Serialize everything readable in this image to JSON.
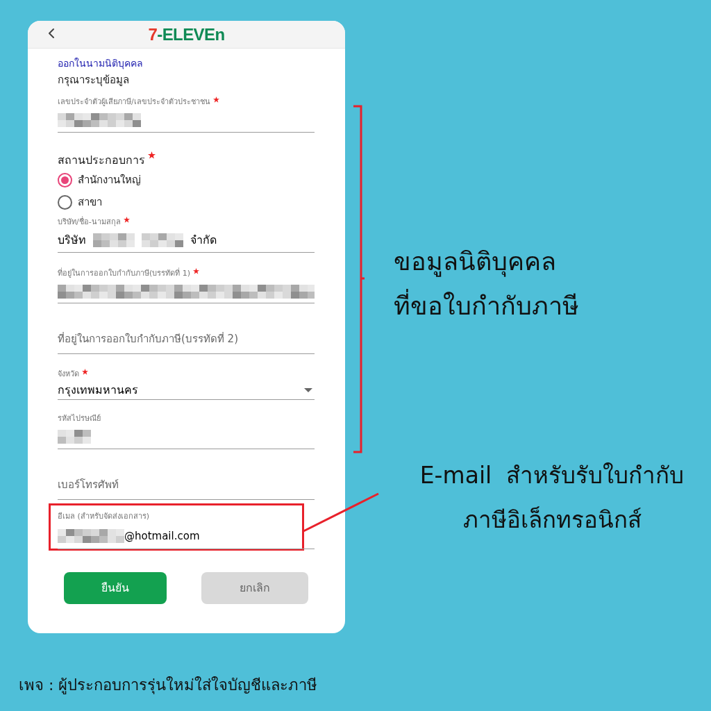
{
  "header": {
    "logo_number": "7",
    "logo_text": "-ELEVEn"
  },
  "form": {
    "section_title": "ออกในนามนิติบุคคล",
    "subtitle": "กรุณาระบุข้อมูล",
    "fields": [
      {
        "kind": "blurred",
        "label": "เลขประจำตัวผู้เสียภาษี/เลขประจำตัวประชาชน",
        "required": true
      },
      {
        "kind": "radio_group",
        "label": "สถานประกอบการ",
        "required": true,
        "options": [
          {
            "label": "สำนักงานใหญ่",
            "selected": true
          },
          {
            "label": "สาขา",
            "selected": false
          }
        ]
      },
      {
        "kind": "company",
        "label": "บริษัท/ชื่อ-นามสกุล",
        "required": true,
        "prefix": "บริษัท",
        "suffix": "จำกัด"
      },
      {
        "kind": "blurred",
        "label": "ที่อยู่ในการออกใบกำกับภาษี(บรรทัดที่ 1)",
        "required": true
      },
      {
        "kind": "placeholder",
        "placeholder": "ที่อยู่ในการออกใบกำกับภาษี(บรรทัดที่ 2)"
      },
      {
        "kind": "select",
        "label": "จังหวัด",
        "required": true,
        "value": "กรุงเทพมหานคร"
      },
      {
        "kind": "blurred",
        "label": "รหัสไปรษณีย์",
        "required": false
      },
      {
        "kind": "placeholder",
        "placeholder": "เบอร์โทรศัพท์"
      },
      {
        "kind": "email",
        "label": "อีเมล (สำหรับจัดส่งเอกสาร)",
        "required": false,
        "value_suffix": "@hotmail.com"
      }
    ],
    "buttons": [
      {
        "kind": "primary",
        "label": "ยืนยัน"
      },
      {
        "kind": "secondary",
        "label": "ยกเลิก"
      }
    ]
  },
  "annotations": [
    {
      "lines": [
        "ขอมูลนิติบุคคล",
        "ที่ขอใบกำกับภาษี"
      ]
    },
    {
      "lines": [
        "E-mail  สำหรับรับใบกำกับ",
        "ภาษีอิเล็กทรอนิกส์"
      ]
    }
  ],
  "footer": "เพจ : ผู้ประกอบการรุ่นใหม่ใส่ใจบัญชีและภาษี"
}
